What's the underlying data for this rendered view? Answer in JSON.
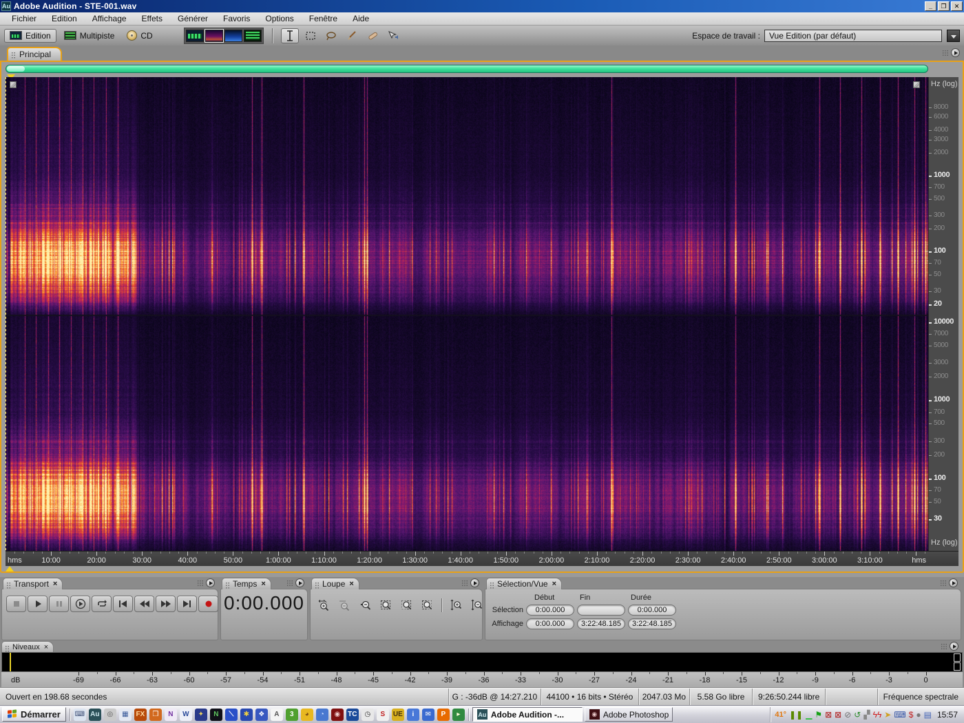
{
  "window": {
    "title": "Adobe Audition - STE-001.wav",
    "app_icon": "Au"
  },
  "menu_bar": {
    "items": [
      "Fichier",
      "Edition",
      "Affichage",
      "Effets",
      "Générer",
      "Favoris",
      "Options",
      "Fenêtre",
      "Aide"
    ]
  },
  "toolbar": {
    "mode_buttons": [
      {
        "label": "Edition"
      },
      {
        "label": "Multipiste"
      },
      {
        "label": "CD"
      }
    ],
    "workspace": {
      "label": "Espace de travail :",
      "value": "Vue Edition (par défaut)"
    }
  },
  "file_tab": {
    "label": "Principal"
  },
  "spectral_view": {
    "freq_axis_unit": "Hz (log)",
    "left_channel_ticks": [
      {
        "f": 8000,
        "label": "8000",
        "bold": false
      },
      {
        "f": 6000,
        "label": "6000",
        "bold": false
      },
      {
        "f": 4000,
        "label": "4000",
        "bold": false
      },
      {
        "f": 3000,
        "label": "3000",
        "bold": false
      },
      {
        "f": 2000,
        "label": "2000",
        "bold": false
      },
      {
        "f": 1000,
        "label": "1000",
        "bold": true
      },
      {
        "f": 700,
        "label": "700",
        "bold": false
      },
      {
        "f": 500,
        "label": "500",
        "bold": false
      },
      {
        "f": 300,
        "label": "300",
        "bold": false
      },
      {
        "f": 200,
        "label": "200",
        "bold": false
      },
      {
        "f": 100,
        "label": "100",
        "bold": true
      },
      {
        "f": 70,
        "label": "70",
        "bold": false
      },
      {
        "f": 50,
        "label": "50",
        "bold": false
      },
      {
        "f": 30,
        "label": "30",
        "bold": false
      },
      {
        "f": 20,
        "label": "20",
        "bold": true
      }
    ],
    "right_channel_ticks": [
      {
        "f": 10000,
        "label": "10000",
        "bold": true
      },
      {
        "f": 7000,
        "label": "7000",
        "bold": false
      },
      {
        "f": 5000,
        "label": "5000",
        "bold": false
      },
      {
        "f": 3000,
        "label": "3000",
        "bold": false
      },
      {
        "f": 2000,
        "label": "2000",
        "bold": false
      },
      {
        "f": 1000,
        "label": "1000",
        "bold": true
      },
      {
        "f": 700,
        "label": "700",
        "bold": false
      },
      {
        "f": 500,
        "label": "500",
        "bold": false
      },
      {
        "f": 300,
        "label": "300",
        "bold": false
      },
      {
        "f": 200,
        "label": "200",
        "bold": false
      },
      {
        "f": 100,
        "label": "100",
        "bold": true
      },
      {
        "f": 70,
        "label": "70",
        "bold": false
      },
      {
        "f": 50,
        "label": "50",
        "bold": false
      },
      {
        "f": 30,
        "label": "30",
        "bold": true
      }
    ],
    "time_ruler": {
      "unit": "hms",
      "labels": [
        "10:00",
        "20:00",
        "30:00",
        "40:00",
        "50:00",
        "1:00:00",
        "1:10:00",
        "1:20:00",
        "1:30:00",
        "1:40:00",
        "1:50:00",
        "2:00:00",
        "2:10:00",
        "2:20:00",
        "2:30:00",
        "2:40:00",
        "2:50:00",
        "3:00:00",
        "3:10:00"
      ],
      "label_interval_seconds": 600,
      "total_seconds": 12168
    }
  },
  "transport_panel": {
    "title": "Transport",
    "buttons": [
      "stop",
      "play",
      "pause",
      "play-from-cursor",
      "play-looped",
      "go-to-start",
      "rewind",
      "fast-forward",
      "go-to-end",
      "record"
    ]
  },
  "time_panel": {
    "title": "Temps",
    "value": "0:00.000"
  },
  "zoom_panel": {
    "title": "Loupe",
    "buttons": [
      "zoom-in-horizontal",
      "zoom-out-horizontal",
      "zoom-out-full",
      "zoom-to-selection",
      "zoom-selection-left",
      "zoom-selection-right",
      "zoom-in-vertical",
      "zoom-out-vertical"
    ]
  },
  "selection_panel": {
    "title": "Sélection/Vue",
    "columns": [
      "Début",
      "Fin",
      "Durée"
    ],
    "rows": [
      {
        "label": "Sélection",
        "debut": "0:00.000",
        "fin": "",
        "duree": "0:00.000"
      },
      {
        "label": "Affichage",
        "debut": "0:00.000",
        "fin": "3:22:48.185",
        "duree": "3:22:48.185"
      }
    ]
  },
  "levels_panel": {
    "title": "Niveaux",
    "unit": "dB",
    "min_db": -69,
    "max_db": 0,
    "label_step_db": 3
  },
  "status_bar": {
    "open_time": "Ouvert en 198.68 secondes",
    "cursor_info": "G : -36dB @ 14:27.210",
    "format_info": "44100 • 16 bits • Stéréo",
    "file_size": "2047.03 Mo",
    "free_space": "5.58 Go libre",
    "free_time": "9:26:50.244 libre",
    "view_mode": "Fréquence spectrale"
  },
  "taskbar": {
    "start_label": "Démarrer",
    "flag_colors": [
      "#e03c00",
      "#60a020",
      "#2060c8",
      "#e8a800"
    ],
    "quick_launch": [
      {
        "name": "keyboard-icon",
        "glyph": "⌨",
        "bg": "#dce4f0",
        "fg": "#44547a"
      },
      {
        "name": "audition-icon",
        "glyph": "Au",
        "bg": "#2a5058",
        "fg": "#cfe8ee"
      },
      {
        "name": "winamp-icon",
        "glyph": "◎",
        "bg": "#cacaca",
        "fg": "#555555"
      },
      {
        "name": "calculator-icon",
        "glyph": "▦",
        "bg": "#e4e8f2",
        "fg": "#3a5a9a"
      },
      {
        "name": "fx-icon",
        "glyph": "FX",
        "bg": "#b84a0a",
        "fg": "#ffd9a0"
      },
      {
        "name": "bridge-icon",
        "glyph": "❒",
        "bg": "#d2691e",
        "fg": "#ffffff"
      },
      {
        "name": "onenote-icon",
        "glyph": "N",
        "bg": "#f0eaf6",
        "fg": "#7030a0"
      },
      {
        "name": "word-icon",
        "glyph": "W",
        "bg": "#eef0f8",
        "fg": "#2a4a9a"
      },
      {
        "name": "planet-icon",
        "glyph": "✦",
        "bg": "#2a3a8a",
        "fg": "#e8d060"
      },
      {
        "name": "netscape-icon",
        "glyph": "N",
        "bg": "#101018",
        "fg": "#60c860"
      },
      {
        "name": "repair-tool-icon",
        "glyph": "⟍",
        "bg": "#2a50c8",
        "fg": "#ffffff"
      },
      {
        "name": "xp-tweak-icon",
        "glyph": "✱",
        "bg": "#2848b0",
        "fg": "#f0d040"
      },
      {
        "name": "blue-doc-icon",
        "glyph": "❖",
        "bg": "#3858c0",
        "fg": "#ffffff"
      },
      {
        "name": "wordpad-icon",
        "glyph": "A",
        "bg": "#f4f4f4",
        "fg": "#555555"
      },
      {
        "name": "mp3-tool-icon",
        "glyph": "3",
        "bg": "#50a030",
        "fg": "#ffffff"
      },
      {
        "name": "globe-yellow-icon",
        "glyph": "◕",
        "bg": "#e8b820",
        "fg": "#805010"
      },
      {
        "name": "globe-blue-icon",
        "glyph": "◔",
        "bg": "#4878d0",
        "fg": "#cfe0ff"
      },
      {
        "name": "irfanview-icon",
        "glyph": "◉",
        "bg": "#801010",
        "fg": "#f0d0d0"
      },
      {
        "name": "total-commander-icon",
        "glyph": "TC",
        "bg": "#1a4a9a",
        "fg": "#ffffff"
      },
      {
        "name": "clock-tool-icon",
        "glyph": "◷",
        "bg": "#e8e8e8",
        "fg": "#333333"
      },
      {
        "name": "sbp-icon",
        "glyph": "S",
        "bg": "#f0f0f0",
        "fg": "#c02020"
      },
      {
        "name": "ultraedit-icon",
        "glyph": "UE",
        "bg": "#d8b020",
        "fg": "#403010"
      },
      {
        "name": "messenger-icon",
        "glyph": "i",
        "bg": "#4878d8",
        "fg": "#ffffff"
      },
      {
        "name": "thunderbird-icon",
        "glyph": "✉",
        "bg": "#3a6ad0",
        "fg": "#ffffff"
      },
      {
        "name": "pdf-icon",
        "glyph": "P",
        "bg": "#e86a00",
        "fg": "#ffffff"
      },
      {
        "name": "media-player-icon",
        "glyph": "▸",
        "bg": "#308a40",
        "fg": "#ffffdd"
      }
    ],
    "tasks": [
      {
        "label": "Adobe Audition -...",
        "icon_glyph": "Au",
        "icon_bg": "#2a5058",
        "icon_fg": "#cfe8ee",
        "active": true
      },
      {
        "label": "Adobe Photoshop",
        "icon_glyph": "◉",
        "icon_bg": "#401014",
        "icon_fg": "#e8c8c8",
        "active": false
      }
    ],
    "tray": {
      "temperature": "41°",
      "icons": [
        {
          "name": "equalizer-tray-icon",
          "glyph": "❚❚",
          "fg": "#5a8a00"
        },
        {
          "name": "minimized-strip-icon",
          "glyph": "▁",
          "fg": "#30c040"
        },
        {
          "name": "flag-tray-icon",
          "glyph": "⚑",
          "fg": "#18a018"
        },
        {
          "name": "network-offline-icon",
          "glyph": "⊠",
          "fg": "#b02020"
        },
        {
          "name": "network-offline-icon-2",
          "glyph": "⊠",
          "fg": "#b02020"
        },
        {
          "name": "blocked-device-icon",
          "glyph": "⊘",
          "fg": "#707070"
        },
        {
          "name": "recycle-tray-icon",
          "glyph": "↺",
          "fg": "#2a8a2a"
        },
        {
          "name": "cat-tray-icon",
          "glyph": "▞",
          "fg": "#888888"
        },
        {
          "name": "av-lightning-icon",
          "glyph": "ϟϟ",
          "fg": "#d01818"
        },
        {
          "name": "cursor-tray-icon",
          "glyph": "➤",
          "fg": "#d0a020"
        },
        {
          "name": "keyboard-layout-icon",
          "glyph": "⌨",
          "fg": "#3858a8"
        },
        {
          "name": "antivirus-dollar-icon",
          "glyph": "$",
          "fg": "#c02020"
        },
        {
          "name": "mouse-tray-icon",
          "glyph": "●",
          "fg": "#777777"
        },
        {
          "name": "clipboard-tray-icon",
          "glyph": "▤",
          "fg": "#4868b8"
        }
      ],
      "clock": "15:57"
    }
  }
}
